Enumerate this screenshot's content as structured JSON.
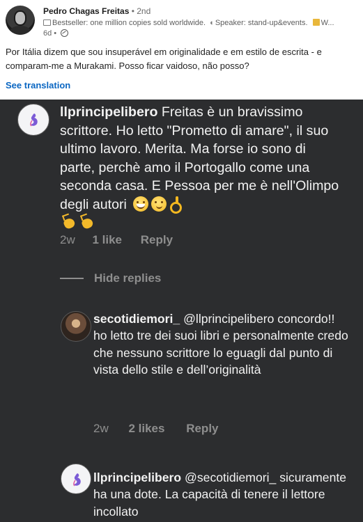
{
  "post": {
    "author": "Pedro Chagas Freitas",
    "degree": "• 2nd",
    "headline_a": "Bestseller: one million copies sold worldwide.",
    "headline_b": "Speaker: stand-up&events.",
    "headline_c": "W...",
    "time": "6d •",
    "text": "Por Itália dizem que sou insuperável em originalidade e em estilo de escrita - e comparam-me a Murakami. Posso ficar vaidoso, não posso?",
    "see_translation": "See translation"
  },
  "ig": {
    "comment1": {
      "username": "llprincipelibero",
      "text": " Freitas è un bravissimo scrittore. Ho letto \"Prometto di amare\", il suo ultimo lavoro. Merita. Ma forse io sono di parte, perchè amo il Portogallo come una seconda casa. E Pessoa per me è nell'Olimpo degli autori",
      "time": "2w",
      "likes": "1 like",
      "reply": "Reply"
    },
    "hide_replies": "Hide replies",
    "reply1": {
      "username": "secotidiemori_",
      "text": " @llprincipelibero concordo!! ho letto tre dei suoi libri e personalmente credo che nessuno scrittore lo eguagli dal punto di vista dello stile e dell’originalità",
      "time": "2w",
      "likes": "2 likes",
      "reply": "Reply"
    },
    "reply2": {
      "username": "llprincipelibero",
      "text": " @secotidiemori_ sicuramente ha una dote. La capacità di tenere il lettore incollato"
    }
  }
}
